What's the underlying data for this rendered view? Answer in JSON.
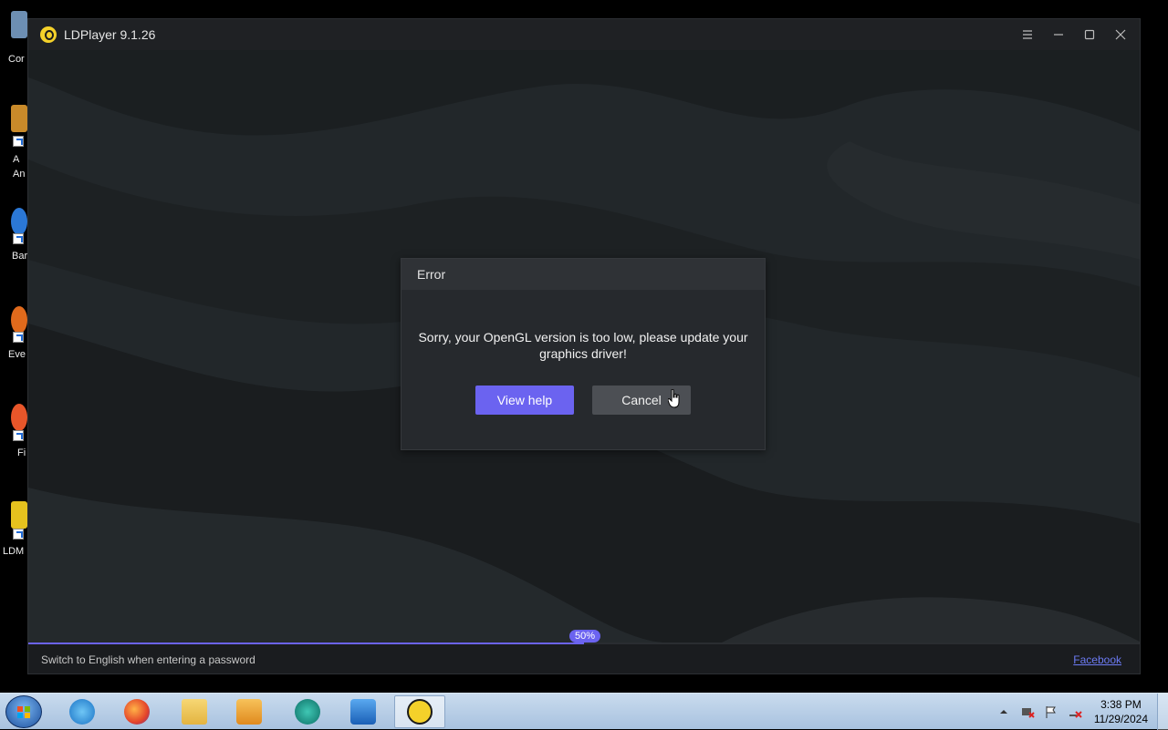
{
  "desktop": {
    "icons": [
      {
        "label": "Cor"
      },
      {
        "label": "A\nAn"
      },
      {
        "label": "Bar"
      },
      {
        "label": "Eve"
      },
      {
        "label": "Fi"
      },
      {
        "label": "LDM"
      }
    ]
  },
  "window": {
    "title": "LDPlayer 9.1.26",
    "controls": [
      "menu-icon",
      "minimize-icon",
      "maximize-icon",
      "close-icon"
    ]
  },
  "dialog": {
    "title": "Error",
    "message": "Sorry, your OpenGL version is too low, please update your graphics driver!",
    "primary_label": "View help",
    "secondary_label": "Cancel"
  },
  "progress": {
    "value": 0.5,
    "label": "50%"
  },
  "statusbar": {
    "tip": "Switch to English when entering a password",
    "link": "Facebook"
  },
  "taskbar": {
    "apps": [
      "internet-explorer-icon",
      "firefox-icon",
      "file-explorer-icon",
      "media-player-icon",
      "teal-app-icon",
      "video-icon",
      "ldplayer-icon"
    ],
    "clock_time": "3:38 PM",
    "clock_date": "11/29/2024"
  },
  "colors": {
    "accent": "#6b63f0",
    "window_bg": "#1e2124",
    "dialog_bg": "#26292d"
  }
}
